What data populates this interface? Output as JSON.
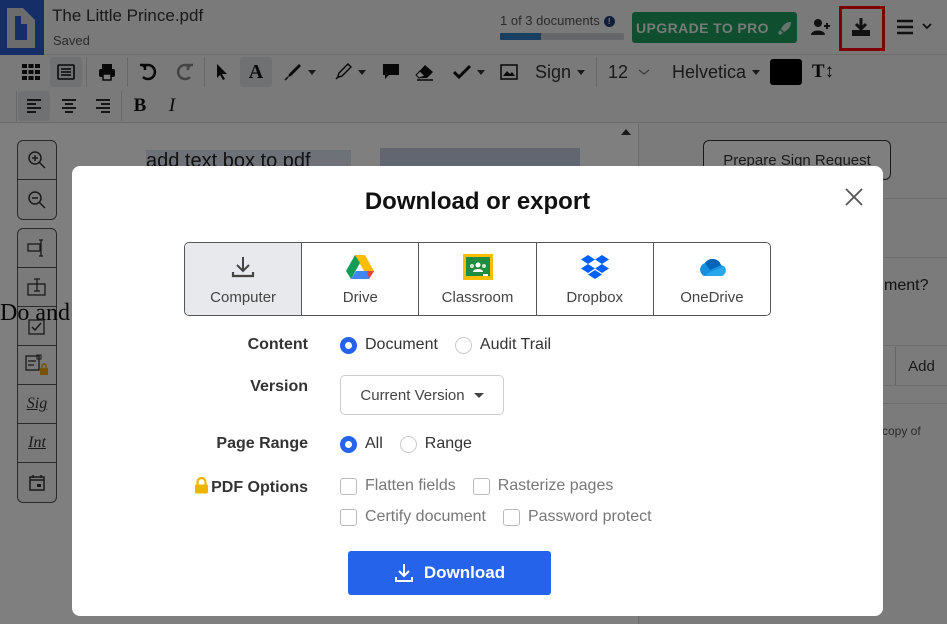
{
  "app": {
    "doc_title": "The Little Prince.pdf",
    "save_status": "Saved",
    "docs_count": "1 of 3 documents",
    "docs_progress_fraction": 0.33,
    "upgrade_label": "UPGRADE TO PRO",
    "colors": {
      "brand_blue": "#2b5ccf",
      "upgrade_green": "#1f9e5e",
      "highlight_red": "#ff0000",
      "primary_blue": "#2563eb"
    }
  },
  "toolbar": {
    "icons": [
      "grid-view-icon",
      "list-view-icon",
      "print-icon",
      "undo-icon",
      "redo-icon",
      "select-arrow-icon",
      "text-tool-icon",
      "pen-icon",
      "highlighter-icon",
      "comment-icon",
      "eraser-icon",
      "checkmark-icon",
      "image-icon",
      "text-size-icon",
      "align-left-icon",
      "align-center-icon",
      "align-right-icon",
      "bold-icon",
      "italic-icon"
    ],
    "sign_label": "Sign",
    "font_size": "12",
    "font_name": "Helvetica",
    "text_color": "#000000"
  },
  "left_tools": [
    "zoom-in-icon",
    "zoom-out-icon",
    "text-field-icon",
    "text-box-icon",
    "checkbox-field-icon",
    "form-lock-icon",
    "signature-icon",
    "initials-icon",
    "date-icon"
  ],
  "document": {
    "line1": "add text box to pdf",
    "line2": "Do and"
  },
  "right_panel": {
    "prepare_label": "Prepare Sign Request",
    "question_fragment": "ment?",
    "add_label": "Add",
    "copy_fragment": "copy of"
  },
  "modal": {
    "title": "Download or export",
    "destinations": [
      {
        "label": "Computer",
        "icon": "download-tray-icon",
        "selected": true
      },
      {
        "label": "Drive",
        "icon": "google-drive-icon",
        "selected": false
      },
      {
        "label": "Classroom",
        "icon": "google-classroom-icon",
        "selected": false
      },
      {
        "label": "Dropbox",
        "icon": "dropbox-icon",
        "selected": false
      },
      {
        "label": "OneDrive",
        "icon": "onedrive-icon",
        "selected": false
      }
    ],
    "content": {
      "label": "Content",
      "options": [
        "Document",
        "Audit Trail"
      ],
      "selected": "Document"
    },
    "version": {
      "label": "Version",
      "value": "Current Version"
    },
    "page_range": {
      "label": "Page Range",
      "options": [
        "All",
        "Range"
      ],
      "selected": "All"
    },
    "pdf_options": {
      "label": "PDF Options",
      "options": [
        {
          "label": "Flatten fields",
          "checked": false
        },
        {
          "label": "Rasterize pages",
          "checked": false
        },
        {
          "label": "Certify document",
          "checked": false
        },
        {
          "label": "Password protect",
          "checked": false
        }
      ]
    },
    "download_label": "Download"
  }
}
